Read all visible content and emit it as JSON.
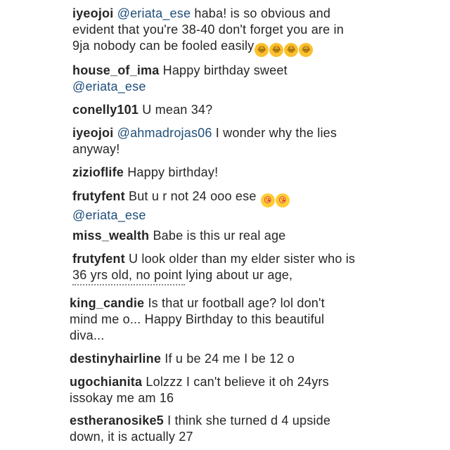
{
  "comments_top": [
    {
      "user": "iyeojoi",
      "mention": "@eriata_ese",
      "text": " haba! is so obvious and evident that you're 38-40 don't forget you are in 9ja nobody can be fooled easily",
      "emoji": [
        "😂",
        "😂",
        "😂",
        "😂"
      ]
    },
    {
      "user": "house_of_ima",
      "text": " Happy birthday sweet ",
      "mention": "@eriata_ese"
    },
    {
      "user": "conelly101",
      "text": " U mean 34?"
    },
    {
      "user": "iyeojoi",
      "mention": "@ahmadrojas06",
      "text": " I wonder why the lies anyway!"
    },
    {
      "user": "zizioflife",
      "text": " Happy birthday!"
    },
    {
      "user": "frutyfent",
      "text": " But u r not 24 ooo ese ",
      "emoji": [
        "😘",
        "😘"
      ],
      "mention": "@eriata_ese"
    },
    {
      "user": "miss_wealth",
      "text": " Babe is this ur real age"
    },
    {
      "user": "frutyfent",
      "text": " U look older than my elder sister who is 36 yrs old, no point lying about ur age,"
    }
  ],
  "comments_bottom": [
    {
      "user": "king_candie",
      "text": " Is that ur football age? lol don't mind me o... Happy Birthday to this beautiful diva..."
    },
    {
      "user": "destinyhairline",
      "text": " If u be 24 me I be 12 o"
    },
    {
      "user": "ugochianita",
      "text": " Lolzzz I can't believe it oh 24yrs issokay me am 16"
    },
    {
      "user": "estheranosike5",
      "text": " I think she turned d 4 upside down, it is actually 27"
    }
  ],
  "colors": {
    "text": "#262626",
    "mention": "#1f4f7a",
    "background": "#ffffff"
  }
}
